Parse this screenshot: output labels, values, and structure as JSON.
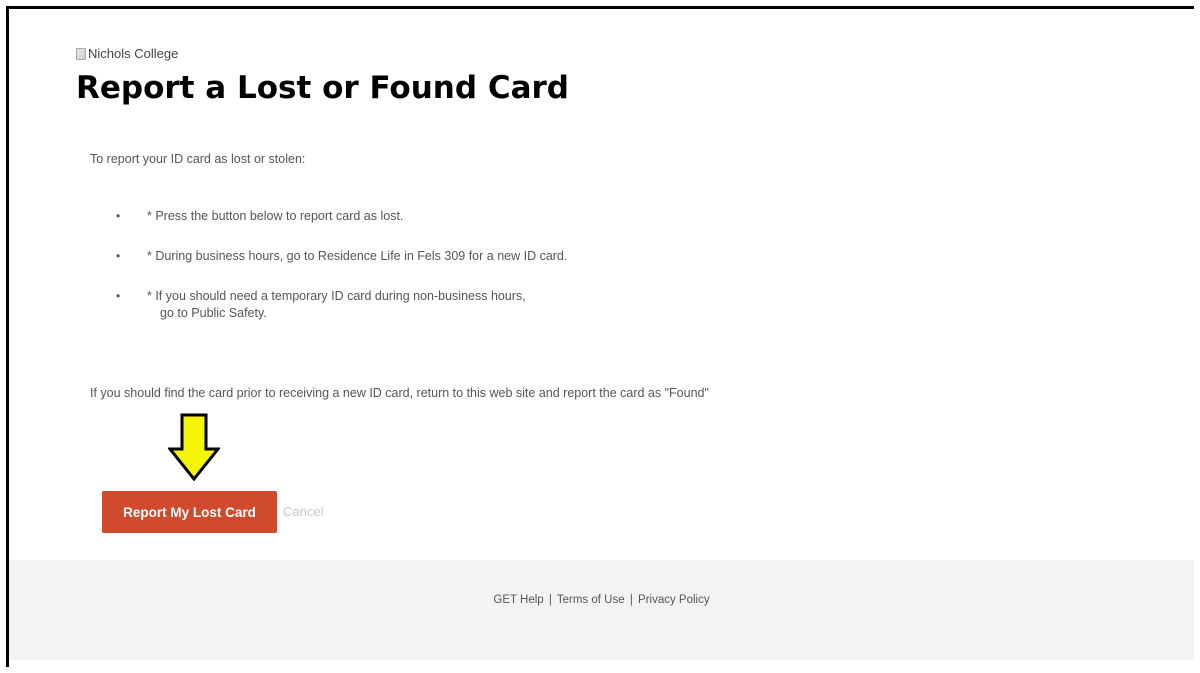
{
  "header": {
    "logo_alt": "Nichols College",
    "title": "Report a Lost or Found Card"
  },
  "main": {
    "intro": "To report your ID card as lost or stolen:",
    "steps": [
      {
        "bullet": "•",
        "line1": "* Press the button below to report card as lost."
      },
      {
        "bullet": "•",
        "line1": "* During business hours, go to Residence Life in Fels 309 for a new ID card."
      },
      {
        "bullet": "•",
        "line1": "* If you should need a temporary ID card during non-business hours,",
        "line2": "go to Public Safety."
      }
    ],
    "found_note": "If you should find the card prior to receiving a new ID card, return to this web site and report the card as \"Found\"",
    "report_button_label": "Report My Lost Card",
    "cancel_label": "Cancel"
  },
  "footer": {
    "help_label": "GET Help",
    "terms_label": "Terms of Use",
    "privacy_label": "Privacy Policy",
    "separator": "|"
  },
  "annotation": {
    "arrow_icon": "down-arrow-icon",
    "arrow_color": "#f5f50a"
  },
  "colors": {
    "button_bg": "#d04a2e",
    "footer_bg": "#f3f3f3"
  }
}
